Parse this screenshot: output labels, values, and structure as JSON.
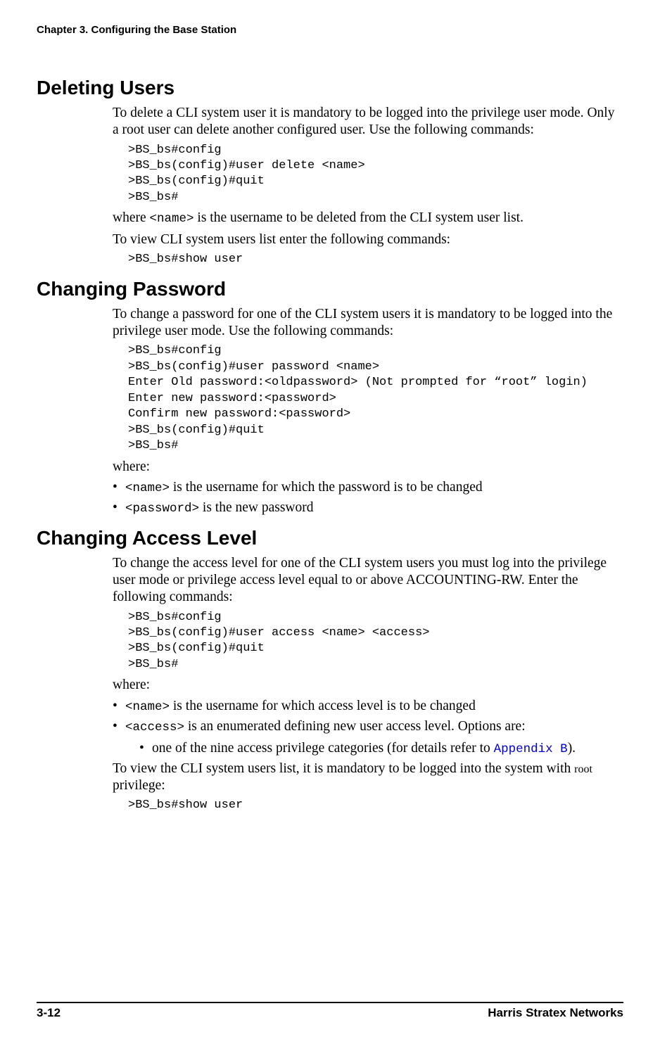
{
  "header": {
    "chapter": "Chapter 3.  Configuring the Base Station"
  },
  "sections": {
    "s1": {
      "title": "Deleting Users",
      "p1": "To delete a CLI system user it is mandatory to be logged into the privilege user mode. Only a root user can delete another configured user. Use the following commands:",
      "code1": ">BS_bs#config\n>BS_bs(config)#user delete <name>\n>BS_bs(config)#quit\n>BS_bs#",
      "p2_a": "where ",
      "p2_code": "<name>",
      "p2_b": " is the username to be deleted from the CLI system user list.",
      "p3": "To view CLI system users list enter the following commands:",
      "code2": ">BS_bs#show user"
    },
    "s2": {
      "title": "Changing Password",
      "p1": "To change a password for one of the CLI system users it is mandatory to be logged into the privilege user mode. Use the following commands:",
      "code1": ">BS_bs#config\n>BS_bs(config)#user password <name>\nEnter Old password:<oldpassword> (Not prompted for “root” login)\nEnter new password:<password>\nConfirm new password:<password>\n>BS_bs(config)#quit\n>BS_bs#",
      "p2": "where:",
      "b1_code": "<name>",
      "b1_text": " is the username for which the password is to be changed",
      "b2_code": "<password>",
      "b2_text": " is the new password"
    },
    "s3": {
      "title": "Changing Access Level",
      "p1": "To change the access level for one of the CLI system users you must log into the privilege user mode or privilege access level equal to or above ACCOUNTING-RW. Enter the following commands:",
      "code1": ">BS_bs#config\n>BS_bs(config)#user access <name> <access>\n>BS_bs(config)#quit\n>BS_bs#",
      "p2": "where:",
      "b1_code": "<name>",
      "b1_text": " is the username for which access level is to be changed",
      "b2_code": "<access>",
      "b2_text": " is an enumerated defining new user access level. Options are:",
      "b2_sub_a": "one of the nine access privilege categories (for details refer to ",
      "b2_sub_link": "Appendix B",
      "b2_sub_b": ").",
      "p3_a": "To view the CLI system users list, it is mandatory to be logged into the system with ",
      "p3_root": "root",
      "p3_b": " privilege:",
      "code2": ">BS_bs#show user"
    }
  },
  "footer": {
    "page": "3-12",
    "company": "Harris Stratex Networks"
  }
}
